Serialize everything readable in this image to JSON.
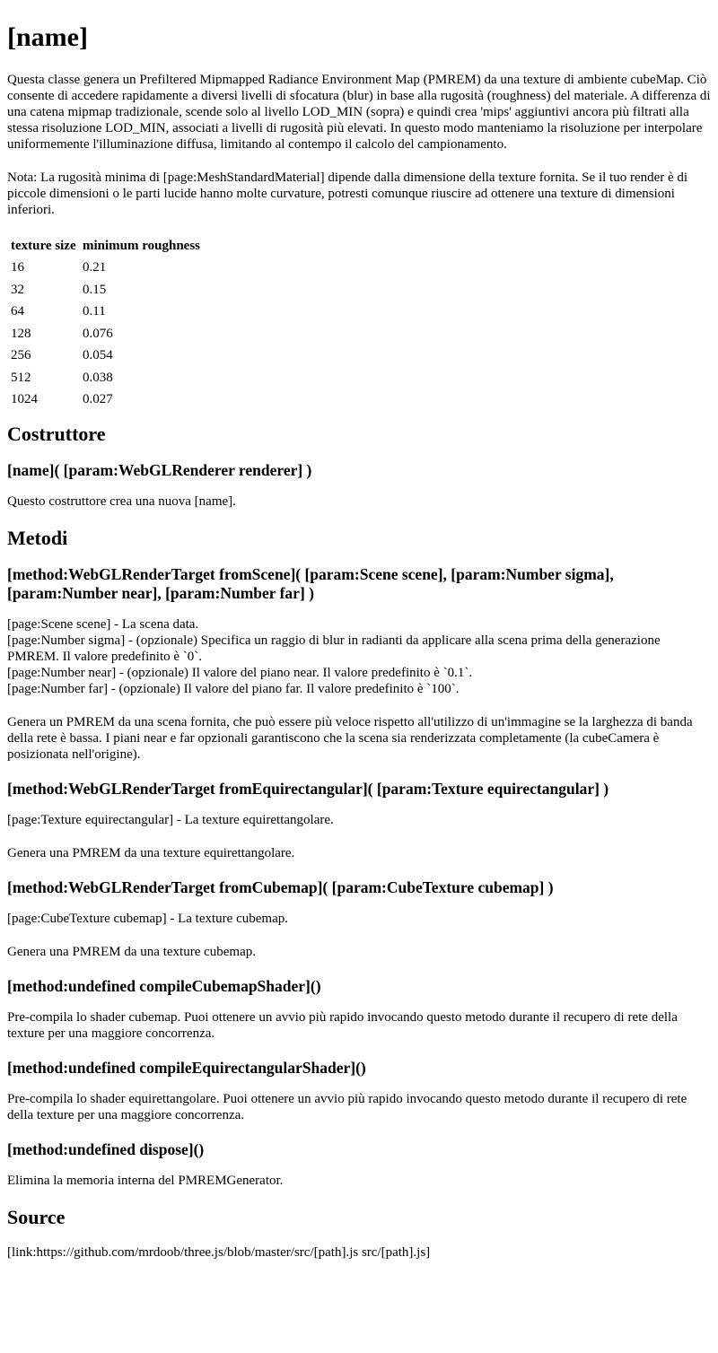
{
  "title": "[name]",
  "intro": "Questa classe genera un Prefiltered Mipmapped Radiance Environment Map (PMREM) da una texture di ambiente cubeMap. Ciò consente di accedere rapidamente a diversi livelli di sfocatura (blur) in base alla rugosità (roughness) del materiale. A differenza di una catena mipmap tradizionale, scende solo al livello LOD_MIN (sopra) e quindi crea 'mips' aggiuntivi ancora più filtrati alla stessa risoluzione LOD_MIN, associati a livelli di rugosità più elevati. In questo modo manteniamo la risoluzione per interpolare uniformemente l'illuminazione diffusa, limitando al contempo il calcolo del campionamento.",
  "note": "Nota: La rugosità minima di [page:MeshStandardMaterial] dipende dalla dimensione della texture fornita. Se il tuo render è di piccole dimensioni o le parti lucide hanno molte curvature, potresti comunque riuscire ad ottenere una texture di dimensioni inferiori.",
  "roughness_table": {
    "headers": [
      "texture size",
      "minimum roughness"
    ],
    "rows": [
      [
        "16",
        "0.21"
      ],
      [
        "32",
        "0.15"
      ],
      [
        "64",
        "0.11"
      ],
      [
        "128",
        "0.076"
      ],
      [
        "256",
        "0.054"
      ],
      [
        "512",
        "0.038"
      ],
      [
        "1024",
        "0.027"
      ]
    ]
  },
  "constructor": {
    "heading": "Costruttore",
    "signature": "[name]( [param:WebGLRenderer renderer] )",
    "description": "Questo costruttore crea una nuova [name]."
  },
  "methods": {
    "heading": "Metodi",
    "from_scene": {
      "signature": "[method:WebGLRenderTarget fromScene]( [param:Scene scene], [param:Number sigma], [param:Number near], [param:Number far] )",
      "params": [
        "[page:Scene scene] - La scena data.",
        "[page:Number sigma] - (opzionale) Specifica un raggio di blur in radianti da applicare alla scena prima della generazione PMREM. Il valore predefinito è `0`.",
        "[page:Number near] - (opzionale) Il valore del piano near. Il valore predefinito è `0.1`.",
        "[page:Number far] - (opzionale) Il valore del piano far. Il valore predefinito è `100`."
      ],
      "description": "Genera un PMREM da una scena fornita, che può essere più veloce rispetto all'utilizzo di un'immagine se la larghezza di banda della rete è bassa. I piani near e far opzionali garantiscono che la scena sia renderizzata completamente (la cubeCamera è posizionata nell'origine)."
    },
    "from_equirectangular": {
      "signature": "[method:WebGLRenderTarget fromEquirectangular]( [param:Texture equirectangular] )",
      "param": "[page:Texture equirectangular] - La texture equirettangolare.",
      "description": "Genera una PMREM da una texture equirettangolare."
    },
    "from_cubemap": {
      "signature": "[method:WebGLRenderTarget fromCubemap]( [param:CubeTexture cubemap] )",
      "param": "[page:CubeTexture cubemap] - La texture cubemap.",
      "description": "Genera una PMREM da una texture cubemap."
    },
    "compile_cubemap_shader": {
      "signature": "[method:undefined compileCubemapShader]()",
      "description": "Pre-compila lo shader cubemap. Puoi ottenere un avvio più rapido invocando questo metodo durante il recupero di rete della texture per una maggiore concorrenza."
    },
    "compile_equirectangular_shader": {
      "signature": "[method:undefined compileEquirectangularShader]()",
      "description": "Pre-compila lo shader equirettangolare. Puoi ottenere un avvio più rapido invocando questo metodo durante il recupero di rete della texture per una maggiore concorrenza."
    },
    "dispose": {
      "signature": "[method:undefined dispose]()",
      "description": "Elimina la memoria interna del PMREMGenerator."
    }
  },
  "source": {
    "heading": "Source",
    "link": "[link:https://github.com/mrdoob/three.js/blob/master/src/[path].js src/[path].js]"
  }
}
